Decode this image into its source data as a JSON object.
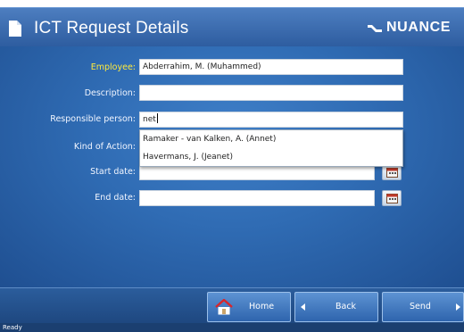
{
  "header": {
    "title": "ICT Request Details",
    "logo_text": "NUANCE"
  },
  "form": {
    "employee_label": "Employee:",
    "employee_value": "Abderrahim, M. (Muhammed)",
    "description_label": "Description:",
    "description_value": "",
    "responsible_label": "Responsible person:",
    "responsible_value": "net",
    "kind_label": "Kind of Action:",
    "start_label": "Start date:",
    "start_value": "",
    "end_label": "End date:",
    "end_value": ""
  },
  "autocomplete": {
    "items": [
      "Ramaker - van Kalken, A. (Annet)",
      "Havermans, J. (Jeanet)"
    ]
  },
  "nav": {
    "home_label": "Home",
    "back_label": "Back",
    "send_label": "Send"
  },
  "status": {
    "text": "Ready"
  },
  "colors": {
    "header_blue": "#3a6cb0",
    "content_blue": "#2f6bb3",
    "employee_label_yellow": "#ffea3c",
    "status_bar": "#1b3f70"
  },
  "icons": {
    "document": "document-icon",
    "calendar": "calendar-icon",
    "home": "home-icon",
    "back": "left-arrow-icon",
    "send": "right-arrow-icon"
  }
}
